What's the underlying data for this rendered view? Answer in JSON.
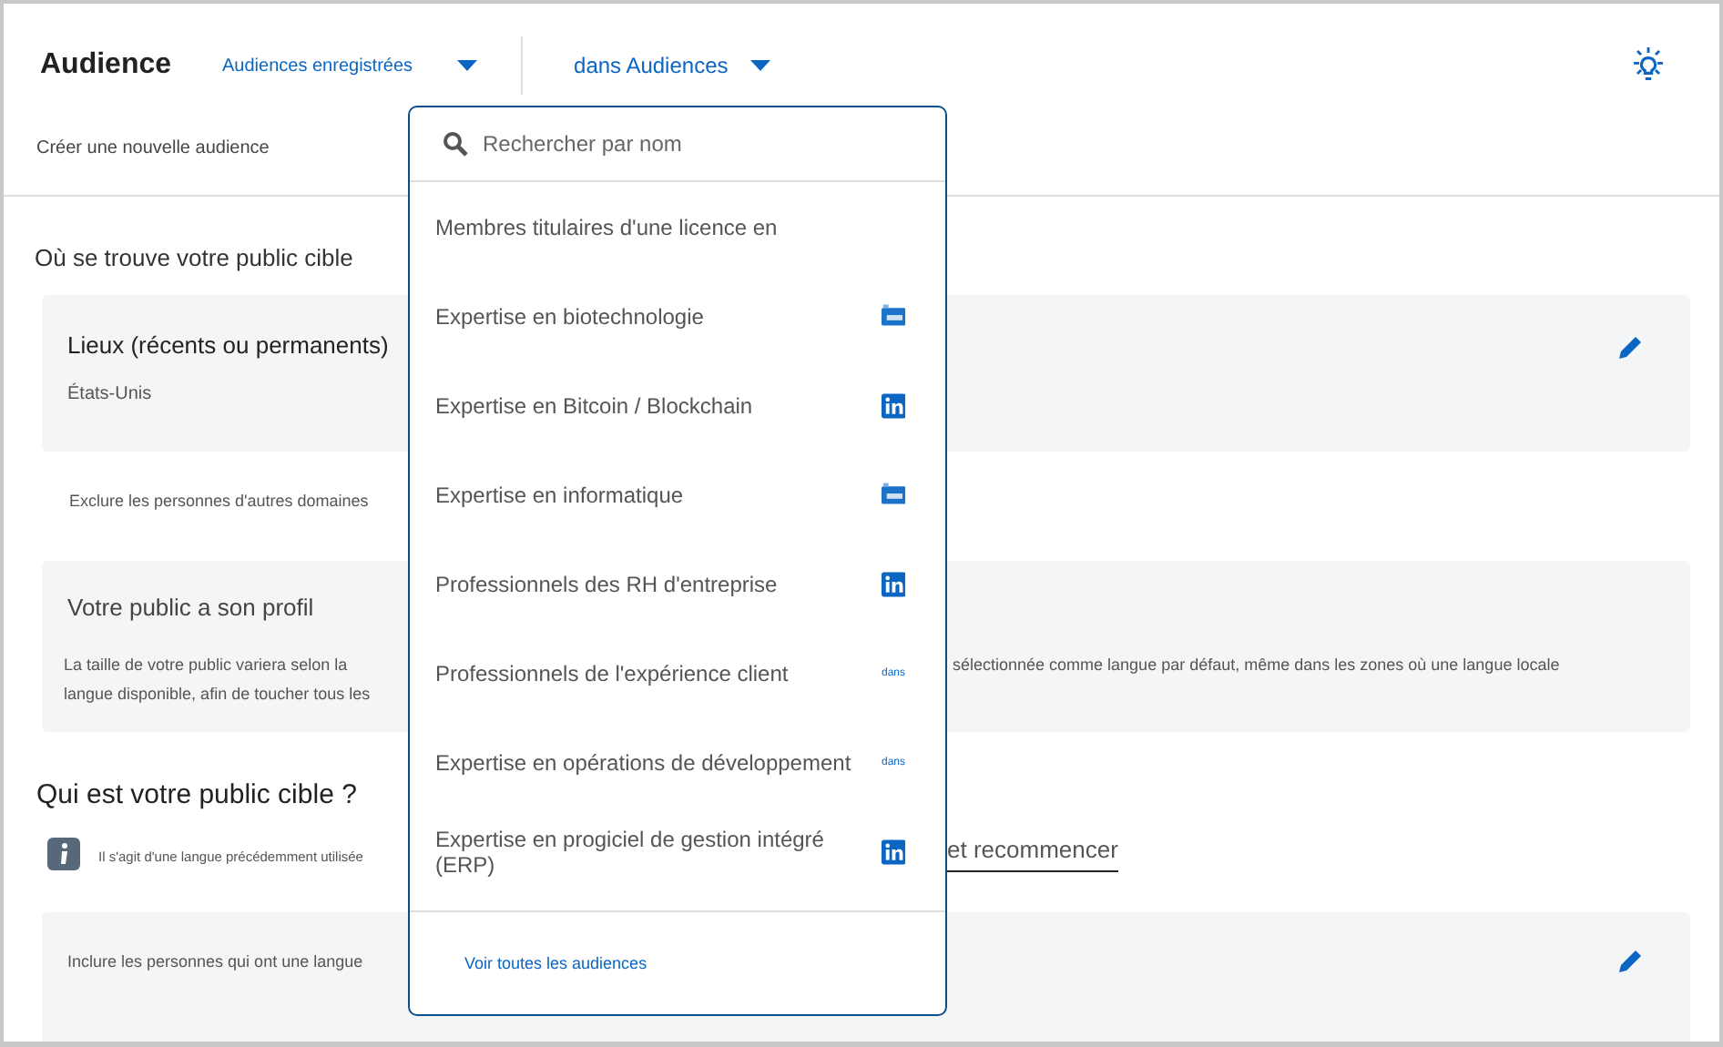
{
  "header": {
    "title": "Audience",
    "saved_dropdown": "Audiences enregistrées",
    "scope_dropdown": "dans Audiences",
    "create_link": "Créer une nouvelle audience"
  },
  "location_section": {
    "heading": "Où se trouve votre public cible",
    "card_title": "Lieux (récents ou permanents)",
    "card_value": "États-Unis",
    "exclude_text": "Exclure les personnes d'autres domaines"
  },
  "profile_card": {
    "title": "Votre public a son profil",
    "text_left": "La taille de votre public variera selon la langue disponible, afin de toucher tous les",
    "text_right": "sélectionnée comme langue par défaut, même dans les zones où une langue locale"
  },
  "who_section": {
    "heading": "Qui est votre public cible ?",
    "info_text": "Il s'agit d'une langue précédemment utilisée",
    "restart_link": "et recommencer",
    "include_text": "Inclure les personnes qui ont une langue"
  },
  "dropdown": {
    "search": {
      "placeholder": "Rechercher par nom"
    },
    "items": [
      {
        "label": "Membres titulaires d'une licence en",
        "kind": "plain"
      },
      {
        "label": "Expertise en biotechnologie",
        "kind": "tile"
      },
      {
        "label": "Expertise en Bitcoin / Blockchain",
        "kind": "logo"
      },
      {
        "label": "Expertise en informatique",
        "kind": "tile"
      },
      {
        "label": "Professionnels des RH d'entreprise",
        "kind": "logo"
      },
      {
        "label": "Professionnels de l'expérience client",
        "kind": "word",
        "badge": "dans"
      },
      {
        "label": "Expertise en opérations de développement",
        "kind": "word",
        "badge": "dans"
      },
      {
        "label": "Expertise en progiciel de gestion intégré (ERP)",
        "kind": "logo"
      }
    ],
    "footer_link": "Voir toutes les audiences"
  }
}
